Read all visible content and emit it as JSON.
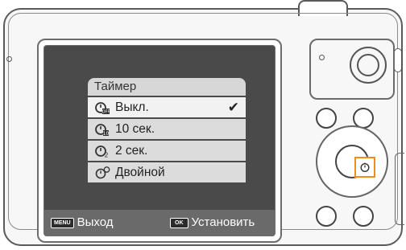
{
  "menu": {
    "title": "Таймер",
    "items": [
      {
        "label": "Выкл.",
        "icon": "timer-off-icon",
        "selected": true
      },
      {
        "label": "10 сек.",
        "icon": "timer-10s-icon",
        "selected": false
      },
      {
        "label": "2 сек.",
        "icon": "timer-2s-icon",
        "selected": false
      },
      {
        "label": "Двойной",
        "icon": "timer-double-icon",
        "selected": false
      }
    ]
  },
  "footer": {
    "menu_key": "MENU",
    "menu_label": "Выход",
    "ok_key": "OK",
    "ok_label": "Установить"
  },
  "colors": {
    "screen_bg": "#4a4a4a",
    "highlight": "#f28c1c"
  }
}
